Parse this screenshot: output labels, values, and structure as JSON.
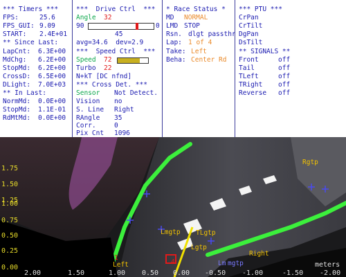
{
  "timers": {
    "title": "*** Timers ***",
    "fps_label": "FPS:",
    "fps_value": "25.6",
    "fps_gui_label": "FPS_GUI:",
    "fps_gui_value": "9.09",
    "start_label": "START:",
    "start_value": "2.4E+01",
    "since_last_title": "** Since Last:",
    "since": [
      {
        "label": "LapCnt:",
        "value": "6.3E+00"
      },
      {
        "label": "MdChg:",
        "value": "6.2E+00"
      },
      {
        "label": "StopMd:",
        "value": "6.2E+00"
      },
      {
        "label": "CrossD:",
        "value": "6.5E+00"
      },
      {
        "label": "DLight:",
        "value": "7.0E+03"
      }
    ],
    "in_last_title": "** In Last:",
    "in_last": [
      {
        "label": "NormMd:",
        "value": "0.0E+00"
      },
      {
        "label": "StopMd:",
        "value": "1.1E-01"
      },
      {
        "label": "RdMtMd:",
        "value": "0.0E+00"
      }
    ]
  },
  "drive": {
    "title": "***  Drive Ctrl  ***",
    "angle_label": "Angle",
    "angle_value": "32",
    "angle_min": "90",
    "angle_max": "0",
    "angle_fraction": 0.72,
    "angle_center": "45",
    "avg_dev": "avg=34.6  dev=2.9",
    "speed_title": "***  Speed Ctrl  ***",
    "speed_label": "Speed",
    "speed_value": "72",
    "speed_fraction": 0.72,
    "turbo_label": "Turbo",
    "turbo_value": "22",
    "nkt": "N+kT [DC nfnd]",
    "cross_title": "*** Cross Det. ***",
    "cross_rows": [
      {
        "label": "Sensor",
        "value": "Not Detect."
      },
      {
        "label": "Vision",
        "value": "no"
      },
      {
        "label": "S. Line",
        "value": "Right"
      },
      {
        "label": "RAngle",
        "value": "35"
      },
      {
        "label": "Corr.",
        "value": "0"
      },
      {
        "label": "Pix Cnt",
        "value": "1096"
      }
    ]
  },
  "race": {
    "title": "* Race Status *",
    "md_label": "MD",
    "md_value": "NORMAL",
    "lmd_label": "LMD",
    "lmd_value": "STOP",
    "rsn_label": "Rsn.",
    "rsn_value": "dlgt passthroDg",
    "lap_label": "Lap:",
    "lap_value": "1 of 4",
    "take_label": "Take:",
    "take_value": "Left",
    "beha_label": "Beha:",
    "beha_value": "Center Rd"
  },
  "ptu": {
    "title": "*** PTU ***",
    "items": [
      "CrPan",
      "CrTilt",
      "DgPan",
      "DsTilt"
    ],
    "signals_title": "** SIGNALS **",
    "signals": [
      {
        "label": "Front",
        "value": "off"
      },
      {
        "label": "Tail",
        "value": "off"
      },
      {
        "label": "TLeft",
        "value": "off"
      },
      {
        "label": "TRight",
        "value": "off"
      },
      {
        "label": "Reverse",
        "value": "off"
      }
    ]
  },
  "camera": {
    "y_ticks": [
      "1.75",
      "1.50",
      "1.25",
      "1.00",
      "0.75",
      "0.50",
      "0.25",
      "0.00"
    ],
    "x_ticks": [
      "2.00",
      "1.50",
      "1.00",
      "0.50",
      "0.00",
      "-0.50",
      "-1.00",
      "-1.50",
      "-2.00"
    ],
    "units": "meters",
    "annotations": {
      "rgtp": "Rgtp",
      "lmgtp": "Lmgtp",
      "tlgtp": "TLgtp",
      "lgtp": "Lgtp",
      "left": "Left",
      "right": "Right",
      "lm": "Lm",
      "mg": "mgtp",
      "one": "1",
      "four": "4"
    }
  }
}
